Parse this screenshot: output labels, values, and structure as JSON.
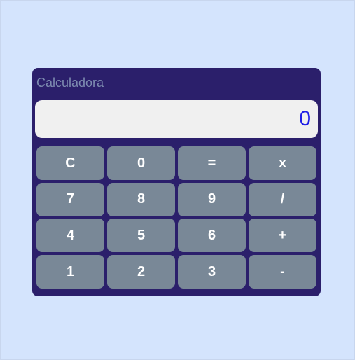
{
  "calculator": {
    "title": "Calculadora",
    "display_value": "0",
    "colors": {
      "background": "#d4e4fd",
      "panel": "#2b1f6b",
      "display": "#f0f0f0",
      "display_text": "#1e1ee6",
      "key": "#798897",
      "key_text": "#ffffff",
      "title_text": "#7d8bb0"
    },
    "keys": {
      "clear": "C",
      "zero": "0",
      "equals": "=",
      "multiply": "x",
      "seven": "7",
      "eight": "8",
      "nine": "9",
      "divide": "/",
      "four": "4",
      "five": "5",
      "six": "6",
      "add": "+",
      "one": "1",
      "two": "2",
      "three": "3",
      "subtract": "-"
    }
  }
}
